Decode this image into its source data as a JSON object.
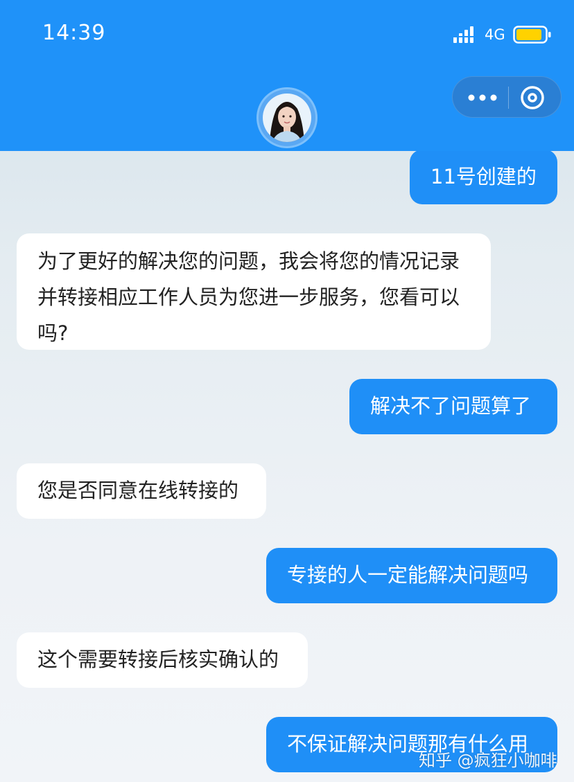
{
  "status_bar": {
    "time": "14:39",
    "network": "4G",
    "signal_icon": "signal-bars-icon",
    "battery_icon": "battery-icon"
  },
  "header": {
    "more_icon": "more-dots-icon",
    "close_icon": "close-circle-icon",
    "avatar": "agent-avatar",
    "background_color": "#1f92f9"
  },
  "messages": [
    {
      "side": "right",
      "text": "11号创建的"
    },
    {
      "side": "left",
      "text": "为了更好的解决您的问题，我会将您的情况记录并转接相应工作人员为您进一步服务，您看可以吗?"
    },
    {
      "side": "right",
      "text": "解决不了问题算了"
    },
    {
      "side": "left",
      "text": "您是否同意在线转接的"
    },
    {
      "side": "right",
      "text": "专接的人一定能解决问题吗"
    },
    {
      "side": "left",
      "text": "这个需要转接后核实确认的"
    },
    {
      "side": "right",
      "text": "不保证解决问题那有什么用"
    }
  ],
  "watermark": "知乎 @疯狂小咖啡",
  "colors": {
    "user_bubble": "#1f8ff7",
    "agent_bubble": "#ffffff"
  }
}
